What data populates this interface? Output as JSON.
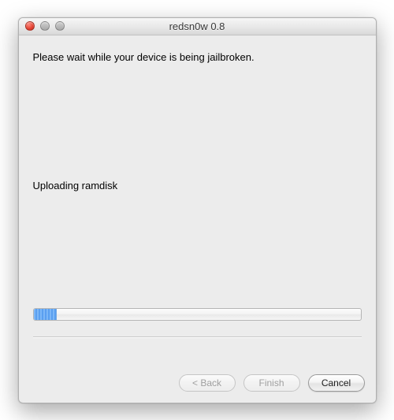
{
  "window": {
    "title": "redsn0w 0.8"
  },
  "content": {
    "instruction": "Please wait while your device is being jailbroken.",
    "status": "Uploading ramdisk",
    "progress_percent": 7
  },
  "buttons": {
    "back": "< Back",
    "finish": "Finish",
    "cancel": "Cancel"
  }
}
